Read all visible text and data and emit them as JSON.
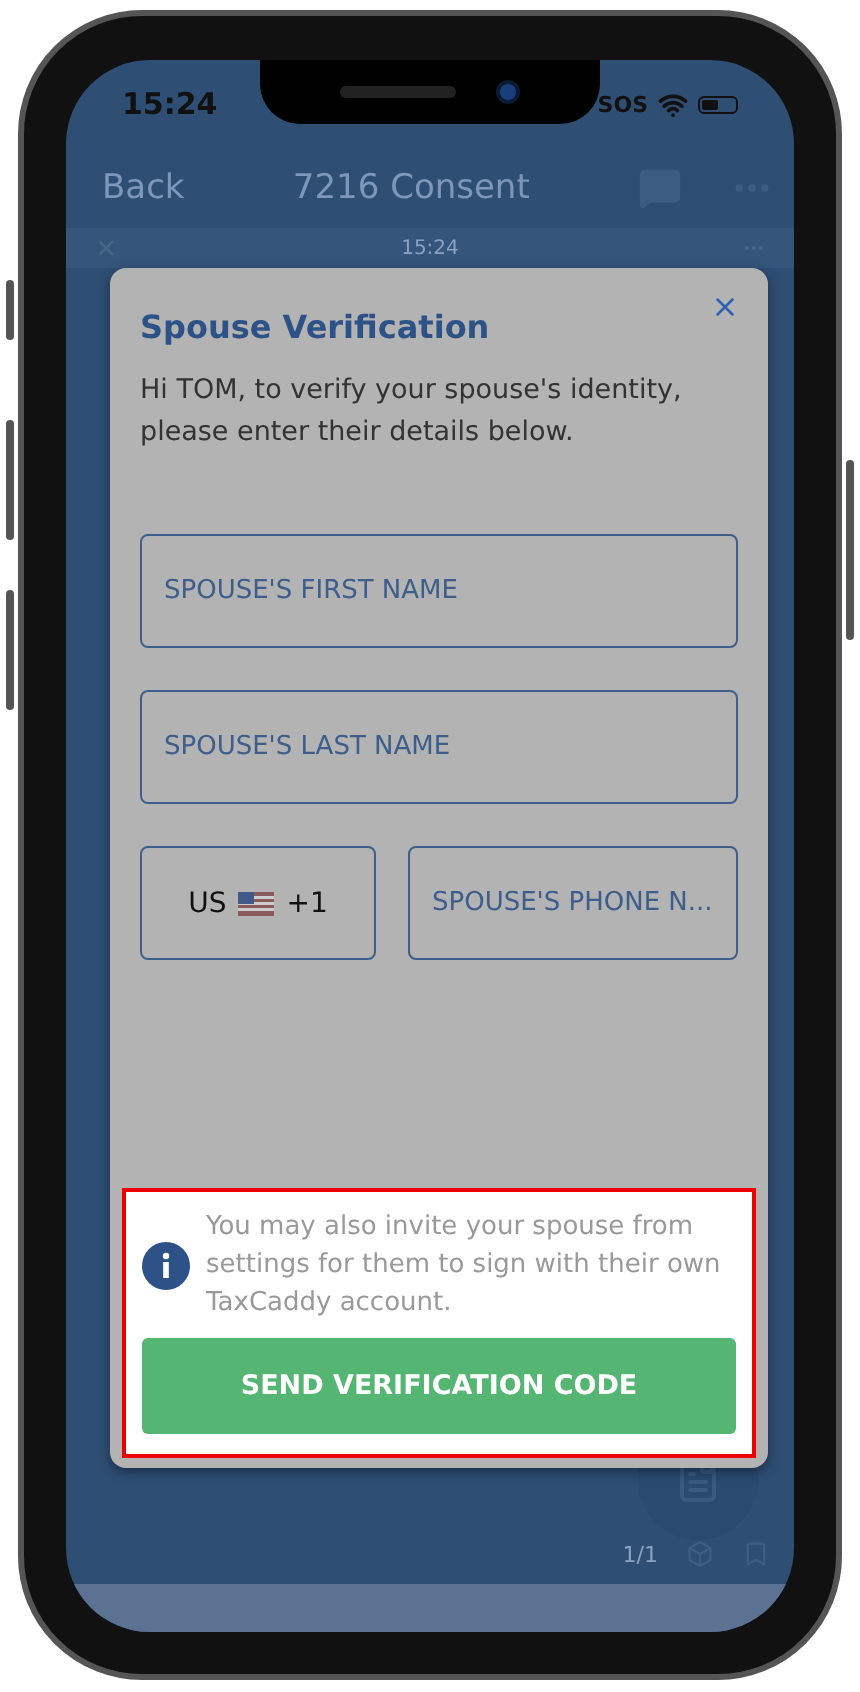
{
  "status_bar": {
    "time": "15:24",
    "carrier": "SOS"
  },
  "nav_bar": {
    "back": "Back",
    "title": "7216 Consent"
  },
  "sub_bar": {
    "time": "15:24"
  },
  "page_counter": "1/1",
  "modal": {
    "title": "Spouse Verification",
    "message": "Hi TOM, to verify your spouse's identity, please enter their details below.",
    "fields": [
      {
        "placeholder": "SPOUSE'S FIRST NAME"
      },
      {
        "placeholder": "SPOUSE'S LAST NAME"
      }
    ],
    "country": {
      "code": "US",
      "dial_code": "+1"
    },
    "phone_field": {
      "placeholder": "SPOUSE'S PHONE N..."
    },
    "hint": "You may also invite your spouse from settings for them to sign with their own TaxCaddy account.",
    "button": "SEND VERIFICATION CODE"
  }
}
